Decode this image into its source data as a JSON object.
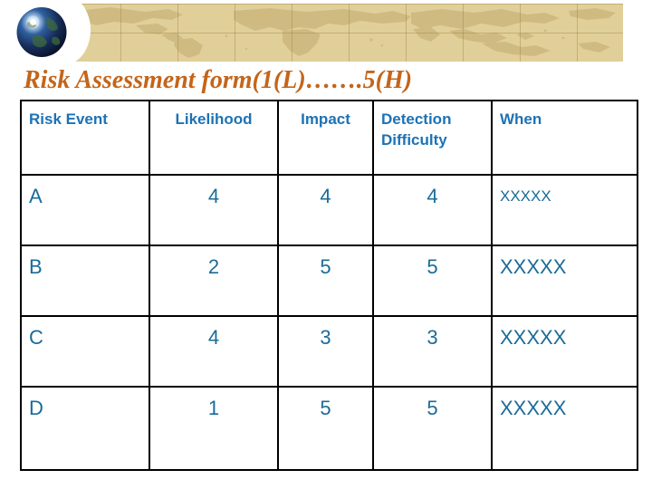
{
  "header": {
    "globe_icon": "globe-icon",
    "banner_image": "world-map-banner"
  },
  "title": "Risk Assessment form(1(L)…….5(H)",
  "table": {
    "columns": [
      {
        "label": "Risk Event",
        "align": "left"
      },
      {
        "label": "Likelihood",
        "align": "center"
      },
      {
        "label": "Impact",
        "align": "center"
      },
      {
        "label": "Detection Difficulty",
        "align": "center"
      },
      {
        "label": "When",
        "align": "left"
      }
    ],
    "rows": [
      {
        "event": "A",
        "likelihood": "4",
        "impact": "4",
        "detection_difficulty": "4",
        "when": "XXXXX"
      },
      {
        "event": "B",
        "likelihood": "2",
        "impact": "5",
        "detection_difficulty": "5",
        "when": "XXXXX"
      },
      {
        "event": "C",
        "likelihood": "4",
        "impact": "3",
        "detection_difficulty": "3",
        "when": "XXXXX"
      },
      {
        "event": "D",
        "likelihood": "1",
        "impact": "5",
        "detection_difficulty": "5",
        "when": "XXXXX"
      }
    ]
  },
  "colors": {
    "title": "#c4651a",
    "header_text": "#1c72b5",
    "cell_text": "#1a6b99",
    "banner_tan": "#e1cf99",
    "banner_land": "#cdb87e",
    "border": "#000000"
  }
}
